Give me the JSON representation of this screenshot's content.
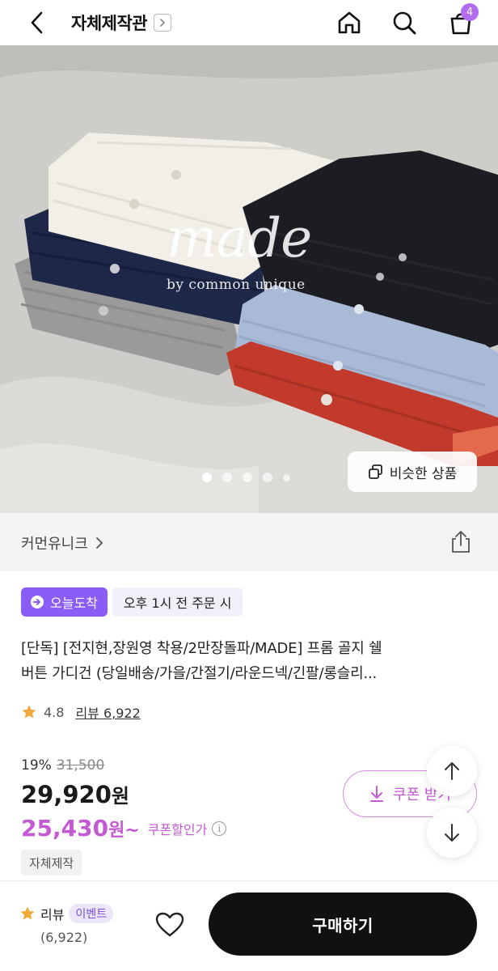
{
  "header": {
    "title": "자체제작관",
    "cart_count": "4",
    "icons": [
      "back-icon",
      "chevron-right-icon",
      "home-icon",
      "search-icon",
      "cart-icon"
    ]
  },
  "hero": {
    "watermark": "made",
    "watermark_sub": "by common unique",
    "similar_label": "비슷한 상품",
    "slide_count": 5,
    "active_slide": 1
  },
  "brand": {
    "name": "커먼유니크"
  },
  "badges": {
    "today_label": "오늘도착",
    "time_label": "오후 1시 전 주문 시"
  },
  "product": {
    "title_line1": "[단독] [전지현,장원영 착용/2만장돌파/MADE] 프롬 골지 쉘",
    "title_line2": "버튼 가디건 (당일배송/가을/간절기/라운드넥/긴팔/롱슬리..."
  },
  "rating": {
    "score": "4.8",
    "review_label": "리뷰 6,922"
  },
  "price": {
    "discount": "19%",
    "original": "31,500",
    "current": "29,920",
    "current_unit": "원",
    "coupon_price": "25,430",
    "coupon_unit": "원~",
    "coupon_note": "쿠폰할인가",
    "info_mark": "i"
  },
  "coupon_button": {
    "label": "쿠폰 받기"
  },
  "tag": {
    "label": "자체제작"
  },
  "bottom": {
    "review_label": "리뷰",
    "event_label": "이벤트",
    "review_count": "(6,922)",
    "buy_label": "구매하기"
  },
  "colors": {
    "accent_purple": "#8b5cf6",
    "coupon_pink": "#c45ad3",
    "buy_button": "#111111",
    "star": "#f0a93b"
  }
}
